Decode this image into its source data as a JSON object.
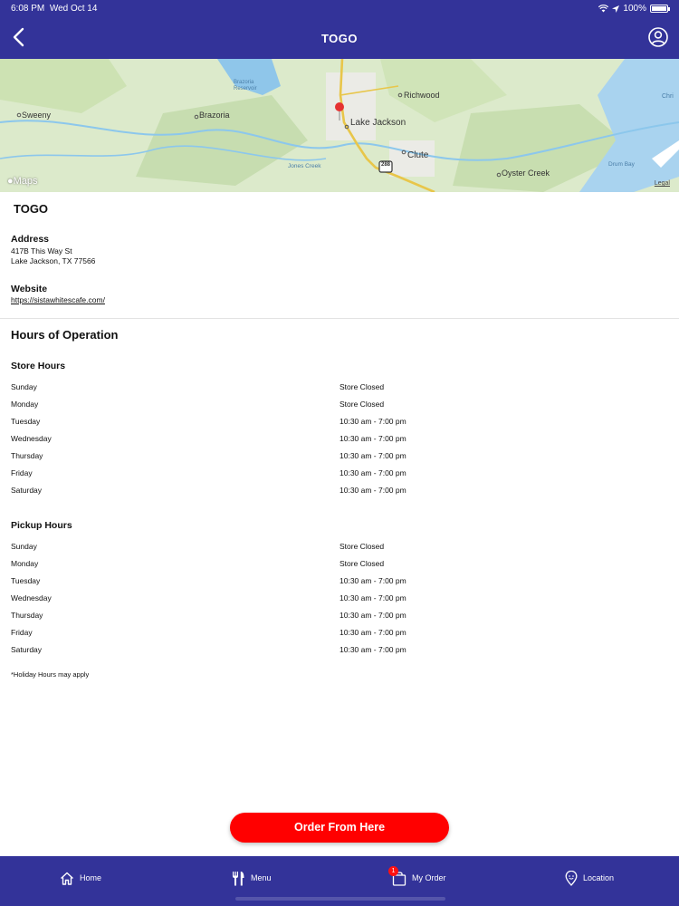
{
  "status_bar": {
    "time": "6:08 PM",
    "date": "Wed Oct 14",
    "battery": "100%"
  },
  "nav": {
    "title": "TOGO",
    "back_icon": "chevron-left-icon",
    "profile_icon": "user-circle-icon"
  },
  "map": {
    "labels": {
      "richwood": "Richwood",
      "sweeny": "Sweeny",
      "brazoria": "Brazoria",
      "lake_jackson": "Lake Jackson",
      "clute": "Clute",
      "oyster_creek": "Oyster Creek",
      "reservoir": "Brazoria Reservoir",
      "jones_creek": "Jones Creek",
      "drum_bay": "Drum Bay",
      "christmas": "Chri",
      "highway": "288"
    },
    "logo": "Maps",
    "legal": "Legal"
  },
  "store": {
    "name": "TOGO",
    "address_label": "Address",
    "address_line1": "417B This Way St",
    "address_line2": "Lake Jackson, TX 77566",
    "website_label": "Website",
    "website": "https://sistawhitescafe.com/"
  },
  "hours": {
    "title": "Hours of Operation",
    "store_title": "Store Hours",
    "store": [
      {
        "day": "Sunday",
        "time": "Store Closed"
      },
      {
        "day": "Monday",
        "time": "Store Closed"
      },
      {
        "day": "Tuesday",
        "time": "10:30 am - 7:00 pm"
      },
      {
        "day": "Wednesday",
        "time": "10:30 am - 7:00 pm"
      },
      {
        "day": "Thursday",
        "time": "10:30 am - 7:00 pm"
      },
      {
        "day": "Friday",
        "time": "10:30 am - 7:00 pm"
      },
      {
        "day": "Saturday",
        "time": "10:30 am - 7:00 pm"
      }
    ],
    "pickup_title": "Pickup Hours",
    "pickup": [
      {
        "day": "Sunday",
        "time": "Store Closed"
      },
      {
        "day": "Monday",
        "time": "Store Closed"
      },
      {
        "day": "Tuesday",
        "time": "10:30 am - 7:00 pm"
      },
      {
        "day": "Wednesday",
        "time": "10:30 am - 7:00 pm"
      },
      {
        "day": "Thursday",
        "time": "10:30 am - 7:00 pm"
      },
      {
        "day": "Friday",
        "time": "10:30 am - 7:00 pm"
      },
      {
        "day": "Saturday",
        "time": "10:30 am - 7:00 pm"
      }
    ],
    "note": "*Holiday Hours may apply"
  },
  "order_button": "Order From Here",
  "tabs": {
    "home": "Home",
    "menu": "Menu",
    "my_order": "My Order",
    "my_order_badge": "1",
    "location": "Location"
  },
  "colors": {
    "primary": "#333399",
    "accent": "#ff0000"
  }
}
